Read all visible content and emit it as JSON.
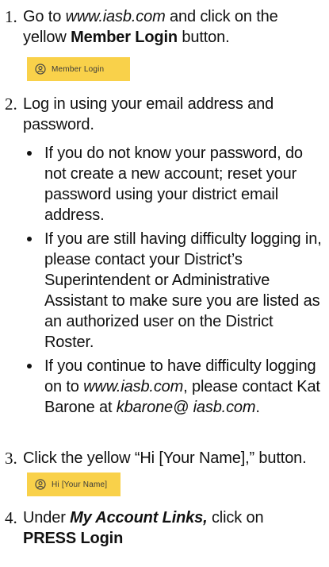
{
  "steps": [
    {
      "number": "1.",
      "pre": "Go to ",
      "link": "www.iasb.com",
      "mid": " and click on the yellow ",
      "bold": "Member Login",
      "post": " button.",
      "button_label": "Member Login"
    },
    {
      "number": "2.",
      "text": "Log in using your email address and password.",
      "bullets": [
        {
          "text": "If you do not know your password, do not create a new account; reset your password using your district email address."
        },
        {
          "text": "If you are still having difficulty logging in, please contact your District’s Superintendent or Admin­istrative Assistant to make sure you are listed as an authorized user on the District Roster."
        },
        {
          "pre": "If you continue to have difficulty logging on to ",
          "link": "www.iasb.com",
          "mid": ", please contact Kat Barone at ",
          "email": "kbarone@ iasb.com",
          "post": "."
        }
      ]
    },
    {
      "number": "3.",
      "text": "Click the yellow “Hi [Your Name],” button.",
      "button_label": "Hi [Your Name]"
    },
    {
      "number": "4.",
      "pre": "Under ",
      "bold_italic": "My Account Links,",
      "mid": " click on ",
      "bold": "PRESS Login"
    }
  ],
  "colors": {
    "button_yellow": "#f9d14a",
    "text": "#111111"
  },
  "icons": {
    "button_icon": "user-circle-icon"
  }
}
